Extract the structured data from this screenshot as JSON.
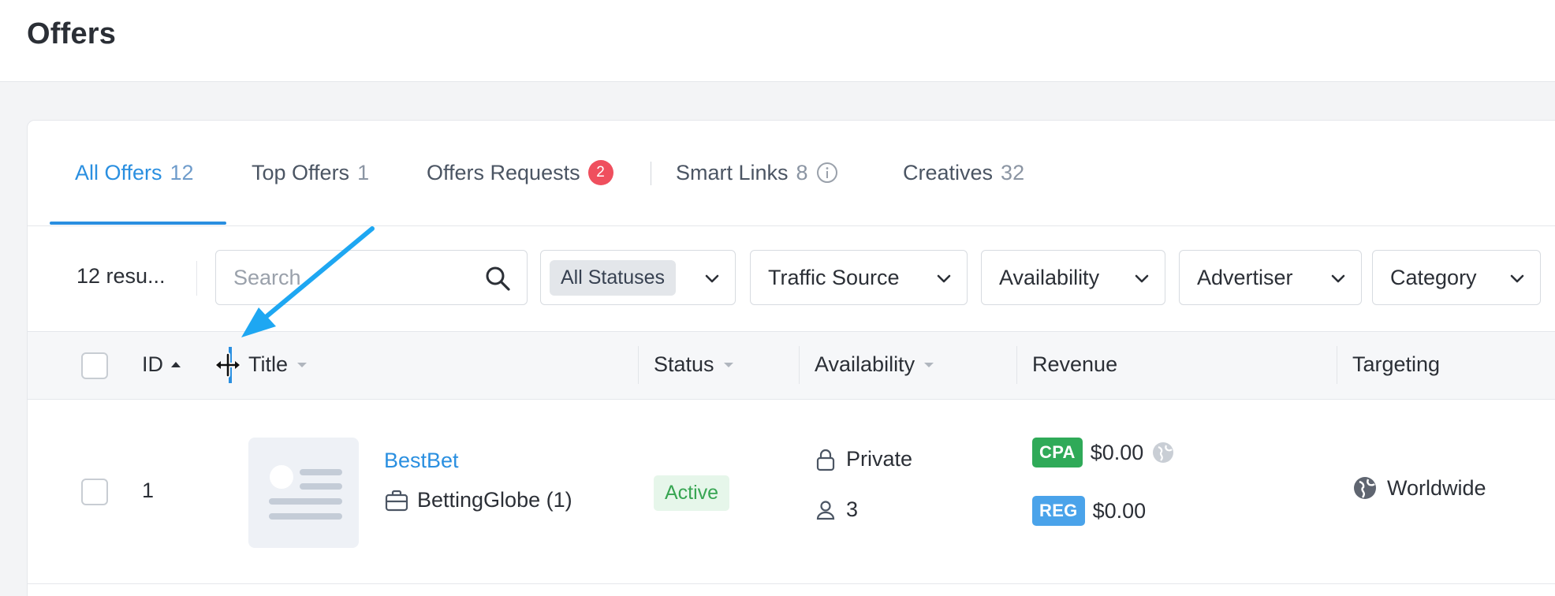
{
  "header": {
    "title": "Offers"
  },
  "tabs": [
    {
      "label": "All Offers",
      "count": "12"
    },
    {
      "label": "Top Offers",
      "count": "1"
    },
    {
      "label": "Offers Requests",
      "badge": "2"
    },
    {
      "label": "Smart Links",
      "count": "8"
    },
    {
      "label": "Creatives",
      "count": "32"
    }
  ],
  "filters": {
    "results": "12  resu...",
    "search_placeholder": "Search",
    "status_chip": "All Statuses",
    "traffic_source": "Traffic Source",
    "availability": "Availability",
    "advertiser": "Advertiser",
    "category": "Category"
  },
  "columns": {
    "id": "ID",
    "title": "Title",
    "status": "Status",
    "availability": "Availability",
    "revenue": "Revenue",
    "targeting": "Targeting"
  },
  "rows": [
    {
      "id": "1",
      "name": "BestBet",
      "advertiser": "BettingGlobe (1)",
      "status": "Active",
      "availability": "Private",
      "affiliates": "3",
      "revenue": [
        {
          "type": "CPA",
          "amount": "$0.00"
        },
        {
          "type": "REG",
          "amount": "$0.00"
        }
      ],
      "targeting": "Worldwide"
    }
  ],
  "colors": {
    "accent": "#2a8fe0",
    "badge": "#ef4f5e",
    "cpa": "#2faa58",
    "reg": "#4aa3ea",
    "active_bg": "#e6f6ea",
    "active_text": "#37a552",
    "annotation_arrow": "#1ea7f2"
  }
}
